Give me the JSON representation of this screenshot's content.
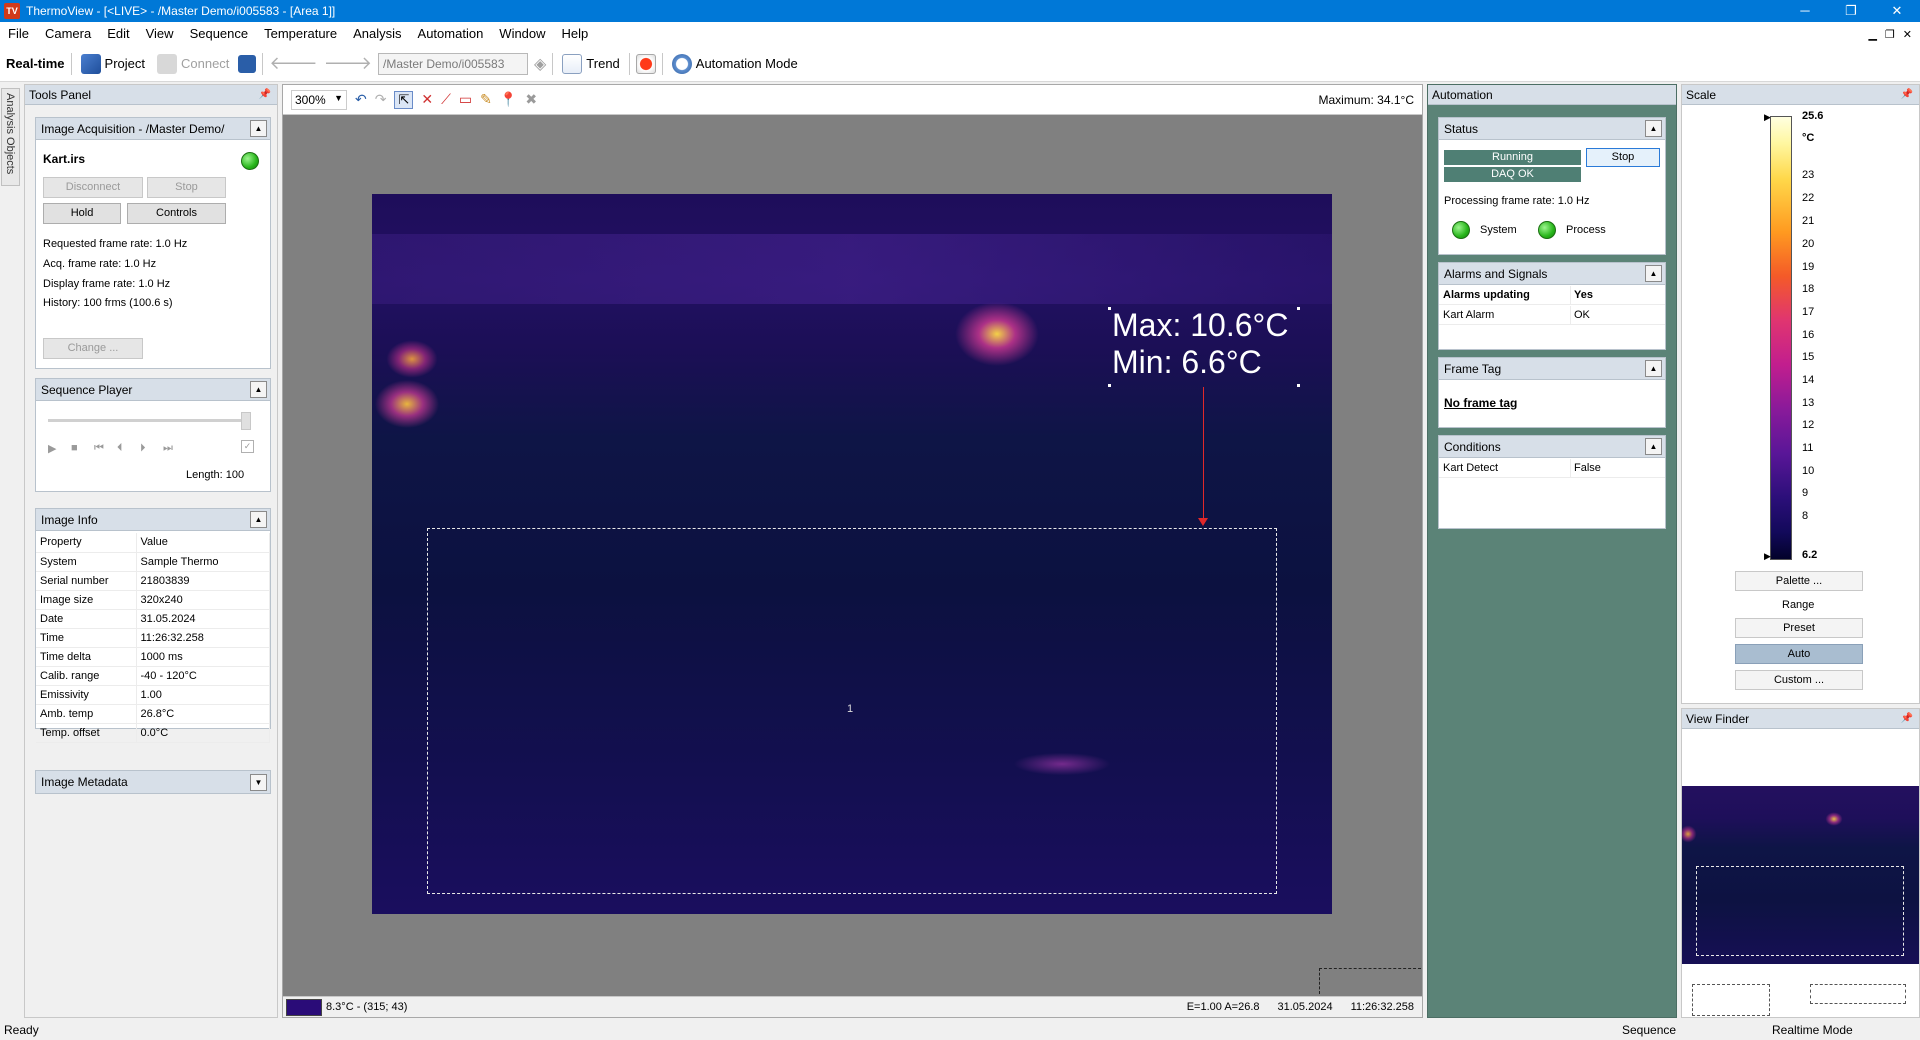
{
  "window": {
    "title": "ThermoView - [<LIVE> - /Master Demo/i005583 - [Area 1]]",
    "app_icon_text": "TV",
    "minimize": "─",
    "maximize": "❐",
    "close": "✕"
  },
  "menu": [
    "File",
    "Camera",
    "Edit",
    "View",
    "Sequence",
    "Temperature",
    "Analysis",
    "Automation",
    "Window",
    "Help"
  ],
  "mdi_controls": {
    "minimize": "▁",
    "restore": "❐",
    "close": "✕"
  },
  "toolbar": {
    "realtime_label": "Real-time",
    "project_label": "Project",
    "connect_label": "Connect",
    "path_value": "/Master Demo/i005583",
    "trend_label": "Trend",
    "automation_mode_label": "Automation Mode"
  },
  "side_tab": {
    "label": "Analysis Objects"
  },
  "tools_panel": {
    "title": "Tools Panel",
    "image_acquisition": {
      "title": "Image Acquisition - /Master Demo/",
      "file": "Kart.irs",
      "disconnect": "Disconnect",
      "stop": "Stop",
      "hold": "Hold",
      "controls": "Controls",
      "requested_frame_rate": "Requested frame rate: 1.0 Hz",
      "acq_frame_rate": "Acq. frame rate: 1.0 Hz",
      "display_frame_rate": "Display frame rate: 1.0 Hz",
      "history": "History: 100 frms (100.6 s)",
      "change": "Change ..."
    },
    "sequence_player": {
      "title": "Sequence Player",
      "length": "Length: 100",
      "controls": [
        "▶",
        "■",
        "⏮",
        "⏴",
        "⏵",
        "⏭"
      ],
      "loop_check": "✓"
    },
    "image_info": {
      "title": "Image Info",
      "header": [
        "Property",
        "Value"
      ],
      "rows": [
        [
          "System",
          "Sample Thermo"
        ],
        [
          "Serial number",
          "21803839"
        ],
        [
          "Image size",
          "320x240"
        ],
        [
          "Date",
          "31.05.2024"
        ],
        [
          "Time",
          "11:26:32.258"
        ],
        [
          "Time delta",
          "1000 ms"
        ],
        [
          "Calib. range",
          "-40 - 120°C"
        ],
        [
          "Emissivity",
          "1.00"
        ],
        [
          "Amb. temp",
          "26.8°C"
        ],
        [
          "Temp. offset",
          "0.0°C"
        ]
      ]
    },
    "image_metadata": {
      "title": "Image Metadata"
    }
  },
  "view": {
    "zoom": "300%",
    "maximum": "Maximum: 34.1°C",
    "overlay_max": "Max: 10.6°C",
    "overlay_min": "Min:  6.6°C",
    "roi_label": "1",
    "status_temp": "8.3°C - (315; 43)",
    "status_ea": "E=1.00 A=26.8",
    "status_date": "31.05.2024",
    "status_time": "11:26:32.258"
  },
  "automation": {
    "title": "Automation",
    "status": {
      "title": "Status",
      "running": "Running",
      "stop": "Stop",
      "daq": "DAQ OK",
      "processing_rate": "Processing frame rate: 1.0 Hz",
      "system": "System",
      "process": "Process"
    },
    "alarms": {
      "title": "Alarms and Signals",
      "rows": [
        [
          "Alarms updating",
          "Yes"
        ],
        [
          "Kart Alarm",
          "OK"
        ]
      ]
    },
    "frame_tag": {
      "title": "Frame Tag",
      "value": "No frame tag"
    },
    "conditions": {
      "title": "Conditions",
      "rows": [
        [
          "Kart Detect",
          "False"
        ]
      ]
    }
  },
  "scale": {
    "title": "Scale",
    "max": "25.6",
    "unit": "°C",
    "ticks": [
      "23",
      "22",
      "21",
      "20",
      "19",
      "18",
      "17",
      "16",
      "15",
      "14",
      "13",
      "12",
      "11",
      "10",
      "9",
      "8"
    ],
    "min": "6.2",
    "palette": "Palette ...",
    "range": "Range",
    "preset": "Preset",
    "auto": "Auto",
    "custom": "Custom ..."
  },
  "viewfinder": {
    "title": "View Finder"
  },
  "statusbar": {
    "ready": "Ready",
    "sequence": "Sequence",
    "mode": "Realtime Mode"
  },
  "colors": {
    "accent": "#0078d7",
    "automation_bg": "#5b8377",
    "ok_green": "#27b51a"
  }
}
